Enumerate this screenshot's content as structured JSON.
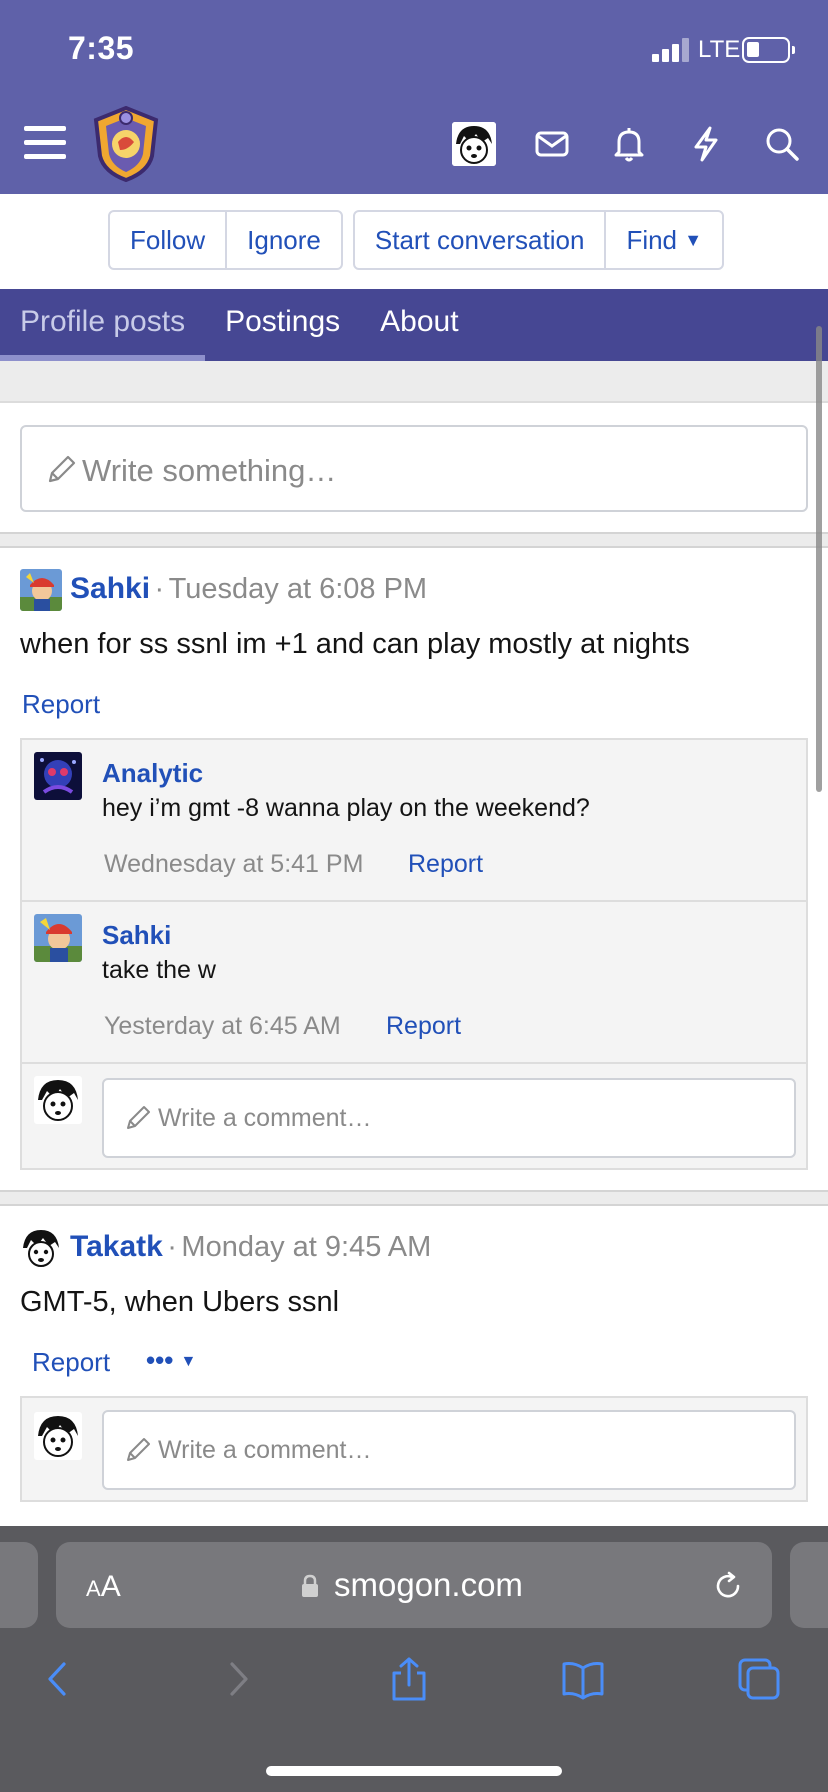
{
  "status_bar": {
    "time": "7:35",
    "network": "LTE",
    "battery_level": 0.2
  },
  "header": {
    "icons": [
      "menu-icon",
      "site-logo",
      "user-avatar",
      "mail-icon",
      "bell-icon",
      "lightning-icon",
      "search-icon"
    ],
    "background": "#5f61a9"
  },
  "actions": {
    "follow": "Follow",
    "ignore": "Ignore",
    "start_conversation": "Start conversation",
    "find": "Find"
  },
  "tabs": [
    {
      "label": "Profile posts",
      "active": true
    },
    {
      "label": "Postings",
      "active": false
    },
    {
      "label": "About",
      "active": false
    }
  ],
  "composer": {
    "placeholder": "Write something…"
  },
  "posts": [
    {
      "author": "Sahki",
      "sep": "·",
      "time": "Tuesday at 6:08 PM",
      "text": "when for ss ssnl im +1 and can play mostly at nights",
      "report": "Report",
      "comments": [
        {
          "author": "Analytic",
          "text": "hey i’m gmt -8 wanna play on the weekend?",
          "time": "Wednesday at 5:41 PM",
          "report": "Report"
        },
        {
          "author": "Sahki",
          "text": "take the w",
          "time": "Yesterday at 6:45 AM",
          "report": "Report"
        }
      ],
      "comment_placeholder": "Write a comment…"
    },
    {
      "author": "Takatk",
      "sep": "·",
      "time": "Monday at 9:45 AM",
      "text": "GMT-5, when Ubers ssnl",
      "report": "Report",
      "more": "•••",
      "comment_placeholder": "Write a comment…"
    }
  ],
  "browser": {
    "aa_big": "A",
    "aa_small": "A",
    "host": "smogon.com",
    "nav_icons": [
      "back-icon",
      "forward-icon",
      "share-icon",
      "bookmarks-icon",
      "tabs-icon"
    ]
  },
  "colors": {
    "link": "#2150b8",
    "header": "#5f61a9",
    "tabbar": "#464793",
    "safari": "#5a5a5e"
  }
}
